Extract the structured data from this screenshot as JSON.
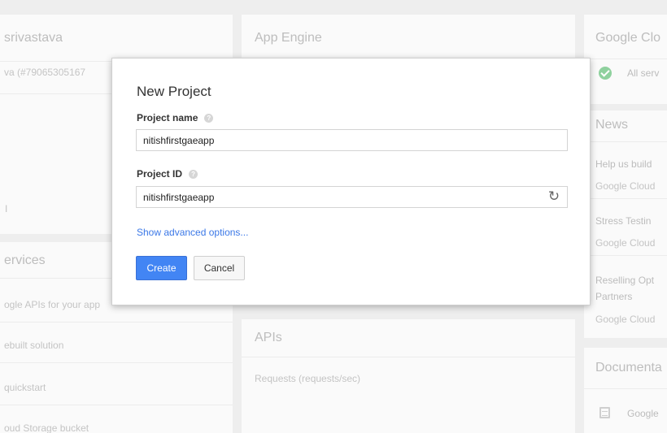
{
  "background": {
    "project_card": {
      "name_text": "srivastava",
      "id_text": "va (#79065305167"
    },
    "app_engine_card": {
      "title": "App Engine"
    },
    "status_card": {
      "title": "Google Clo",
      "status_text": "All serv"
    },
    "services_card": {
      "title": "ervices",
      "items": [
        "ogle APIs for your app",
        "ebuilt solution",
        "quickstart",
        "oud Storage bucket"
      ]
    },
    "news_card": {
      "title": "News",
      "items": [
        {
          "headline": "Help us build",
          "source": "Google Cloud"
        },
        {
          "headline": "Stress Testin",
          "source": "Google Cloud"
        },
        {
          "headline": "Reselling Opt",
          "subline": "Partners",
          "source": "Google Cloud"
        }
      ]
    },
    "apis_card": {
      "title": "APIs",
      "subtitle": "Requests (requests/sec)"
    },
    "documentation_card": {
      "title": "Documenta",
      "item": "Google"
    },
    "left_partial_text": "I"
  },
  "dialog": {
    "title": "New Project",
    "project_name_label": "Project name",
    "project_name_value": "nitishfirstgaeapp",
    "project_id_label": "Project ID",
    "project_id_value": "nitishfirstgaeapp",
    "help_glyph": "?",
    "refresh_glyph": "↻",
    "advanced_link": "Show advanced options...",
    "create_label": "Create",
    "cancel_label": "Cancel"
  },
  "colors": {
    "primary": "#4285f4",
    "link": "#3b78e7",
    "status_ok": "#8fd19e",
    "page_bg": "#eeeeee"
  },
  "icons": [
    "help-icon",
    "refresh-icon",
    "check-circle-icon",
    "document-icon"
  ]
}
